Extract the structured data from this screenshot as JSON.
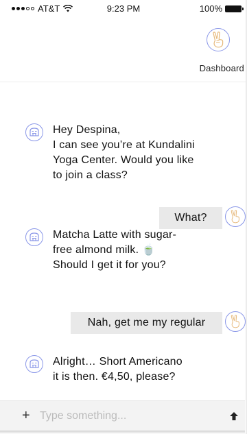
{
  "status_bar": {
    "carrier": "AT&T",
    "time": "9:23 PM",
    "battery": "100%"
  },
  "header": {
    "dashboard_label": "Dashboard",
    "icon": "peace-hand-icon"
  },
  "messages": [
    {
      "from": "bot",
      "lines": [
        "Hey Despina,",
        "I can see you’re at Kundalini",
        "Yoga Center. Would you like",
        "to join a class?"
      ]
    },
    {
      "from": "user",
      "text": "What?"
    },
    {
      "from": "bot",
      "lines": [
        "Matcha Latte with sugar-",
        "free almond milk. 🍵",
        "Should I get it for you?"
      ]
    },
    {
      "from": "user",
      "text": "Nah, get me my regular"
    },
    {
      "from": "bot",
      "lines": [
        "Alright… Short Americano",
        "it is then. €4,50, please?"
      ]
    }
  ],
  "composer": {
    "plus": "+",
    "placeholder": "Type something..."
  },
  "colors": {
    "accent": "#8a97e8",
    "bubble": "#e9e9e9"
  }
}
